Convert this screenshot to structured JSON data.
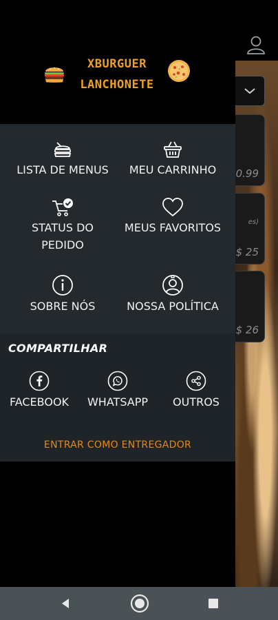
{
  "background_screen": {
    "prices": [
      "0.99",
      "$ 25",
      "$ 26"
    ],
    "note": "es)"
  },
  "drawer": {
    "brand": {
      "line1": "XBURGUER",
      "line2": "LANCHONETE"
    },
    "menu": {
      "menu_list": "LISTA DE MENUS",
      "cart": "MEU CARRINHO",
      "order_status_line1": "STATUS DO",
      "order_status_line2": "PEDIDO",
      "favorites": "MEUS FAVORITOS",
      "about": "SOBRE NÓS",
      "policy": "NOSSA POLÍTICA"
    },
    "share": {
      "title": "COMPARTILHAR",
      "facebook": "FACEBOOK",
      "whatsapp": "WHATSAPP",
      "others": "OUTROS"
    },
    "courier_login": "ENTRAR COMO ENTREGADOR"
  },
  "colors": {
    "drawer_bg": "#000000",
    "menu_panel": "#23292d",
    "share_panel": "#1f2428",
    "brand_accent": "#f0a020",
    "link_accent": "#e08a1e",
    "navbar": "#4b5256"
  },
  "icons": {
    "menu_list": "food-tray-icon",
    "cart": "basket-icon",
    "order_status": "cart-check-icon",
    "favorites": "heart-icon",
    "about": "info-icon",
    "policy": "user-shield-icon",
    "facebook": "facebook-icon",
    "whatsapp": "whatsapp-icon",
    "others": "share-icon"
  }
}
